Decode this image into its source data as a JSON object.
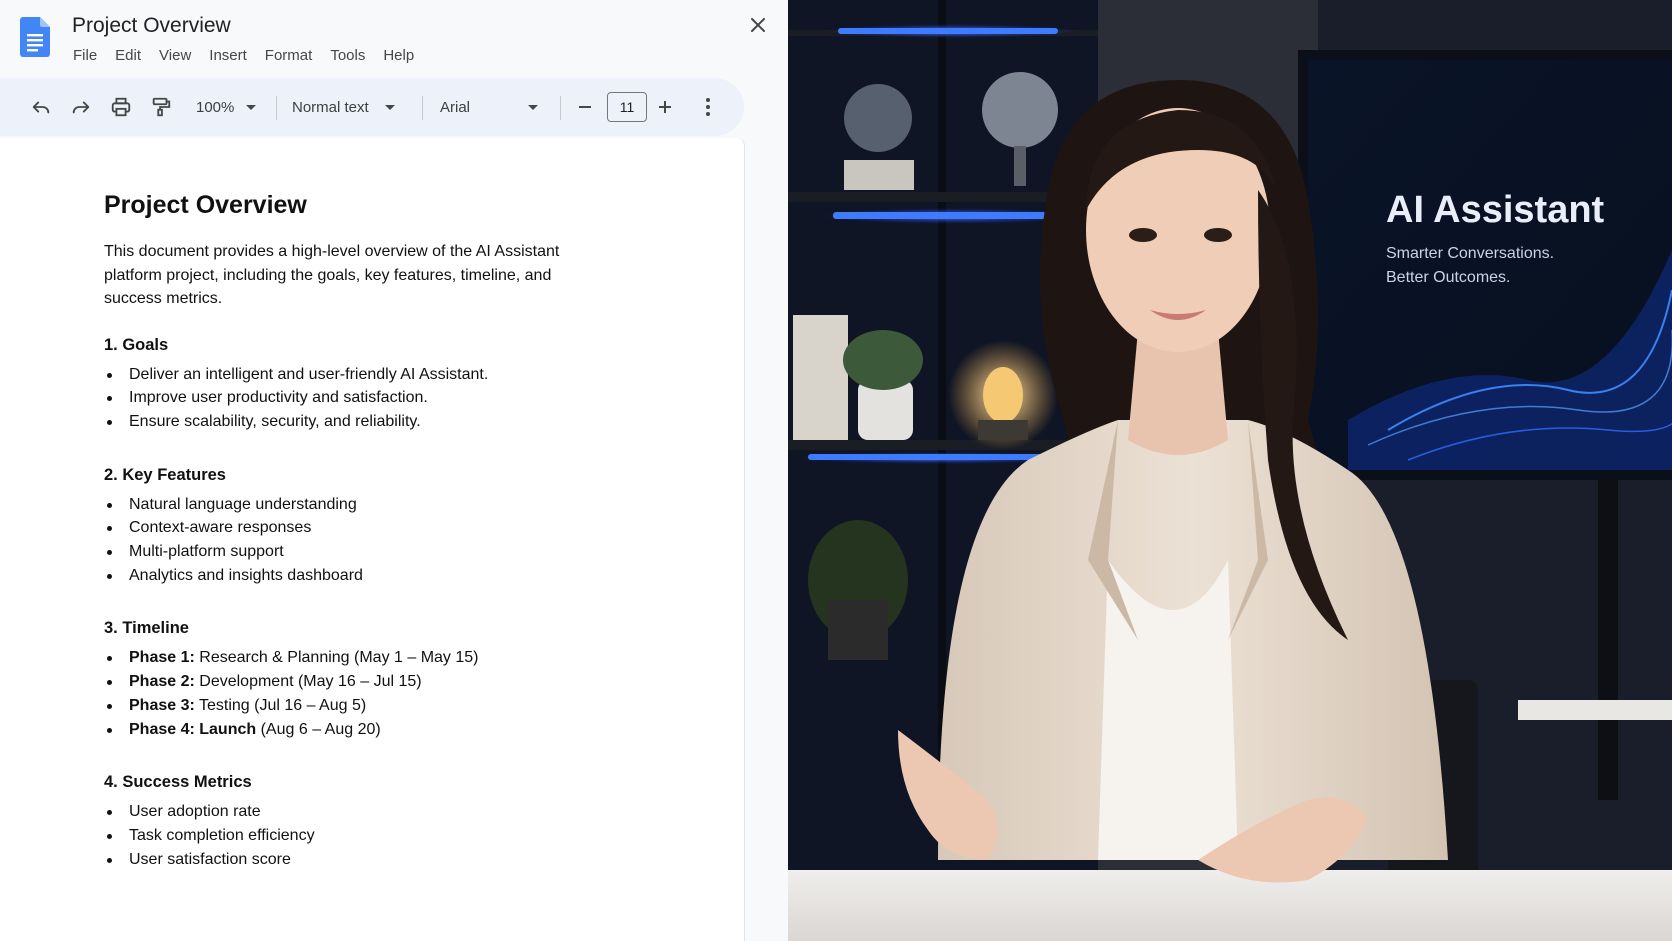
{
  "document": {
    "app_title": "Project Overview",
    "menu": [
      "File",
      "Edit",
      "View",
      "Insert",
      "Format",
      "Tools",
      "Help"
    ],
    "toolbar": {
      "zoom": "100%",
      "style": "Normal text",
      "font": "Arial",
      "font_size": "11"
    },
    "content": {
      "heading": "Project Overview",
      "intro": "This document provides a high-level overview of the AI Assistant platform project, including the goals, key features, timeline, and success metrics.",
      "sections": [
        {
          "title": "1. Goals",
          "items": [
            "Deliver an intelligent and user-friendly AI Assistant.",
            "Improve user productivity and satisfaction.",
            "Ensure scalability, security, and reliability."
          ]
        },
        {
          "title": "2. Key Features",
          "items": [
            "Natural language understanding",
            "Context-aware responses",
            "Multi-platform support",
            "Analytics and insights dashboard"
          ]
        },
        {
          "title": "3. Timeline",
          "phases": [
            {
              "label": "Phase 1",
              "sep": ":",
              "text": " Research & Planning (May 1 – May 15)"
            },
            {
              "label": "Phase 2",
              "sep": ":",
              "text": " Development (May 16 – Jul 15)"
            },
            {
              "label": "Phase 3",
              "sep": ":",
              "text": " Testing (Jul 16 – Aug 5)"
            },
            {
              "label": "Phase 4",
              "sep": ": Launch",
              "text": " (Aug 6 – Aug 20)"
            }
          ]
        },
        {
          "title": "4. Success Metrics",
          "items": [
            "User adoption rate",
            "Task completion efficiency",
            "User satisfaction score"
          ]
        }
      ]
    }
  },
  "video": {
    "screen_title": "AI Assistant",
    "screen_subtitle_line1": "Smarter Conversations.",
    "screen_subtitle_line2": "Better Outcomes."
  },
  "colors": {
    "docs_blue": "#4285f4",
    "toolbar_bg": "#edf2fa",
    "neon_blue": "#2f6bff",
    "blazer": "#e8dccf"
  }
}
